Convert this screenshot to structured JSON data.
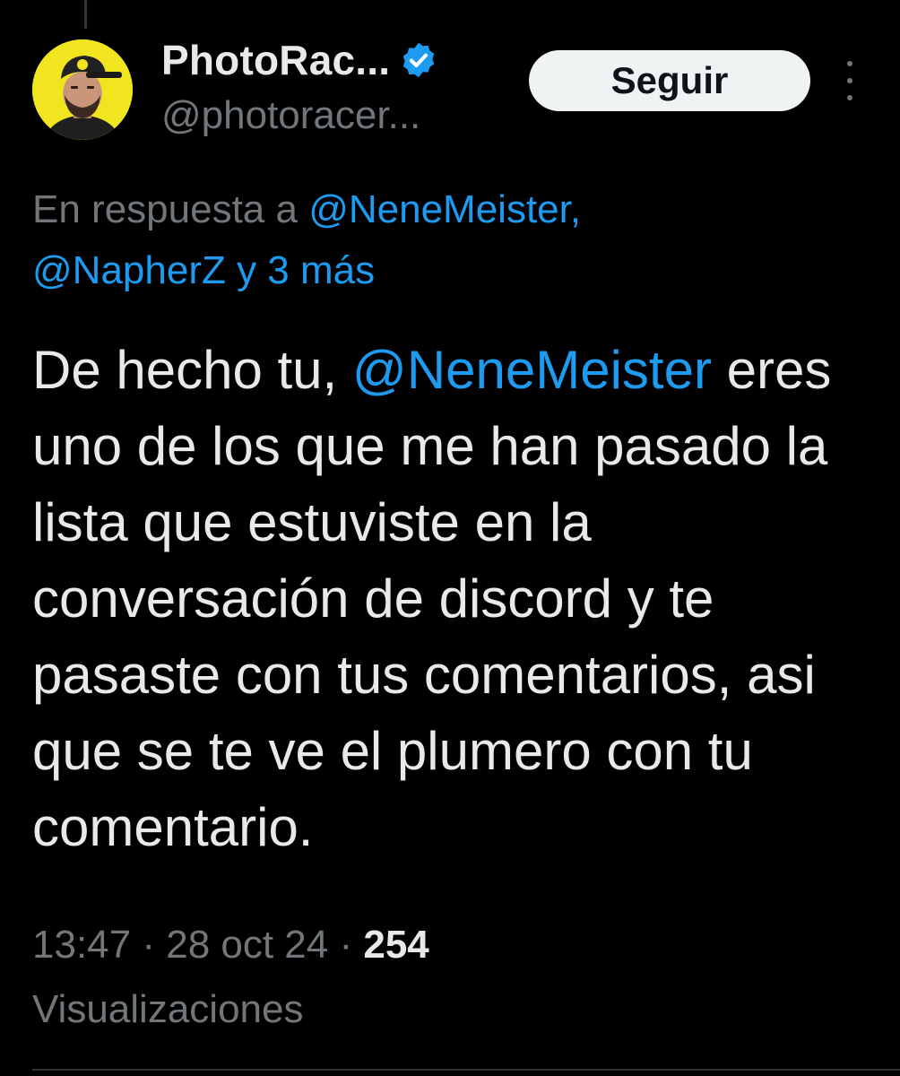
{
  "author": {
    "display_name": "PhotoRac...",
    "handle": "@photoracer...",
    "verified": true,
    "avatar_bg": "#f1e51f"
  },
  "actions": {
    "follow_label": "Seguir",
    "more_icon": "more-vertical-icon"
  },
  "reply_context": {
    "prefix": "En respuesta a ",
    "mention_1": "@NeneMeister,",
    "mention_2": "@NapherZ y 3 más"
  },
  "tweet": {
    "text_before": "De hecho tu, ",
    "mention": "@NeneMeister",
    "text_after": " eres uno de los que me han pasado la lista que estuviste en la conversación de discord y te pasaste con tus comentarios, asi que se te ve el plumero con tu comentario."
  },
  "meta": {
    "time": "13:47",
    "date": "28 oct 24",
    "separator": " · ",
    "views_count": "254",
    "views_label": "Visualizaciones"
  },
  "colors": {
    "background": "#000000",
    "text": "#e7e9ea",
    "secondary": "#71767b",
    "link": "#1d9bf0",
    "follow_bg": "#eff3f4"
  }
}
